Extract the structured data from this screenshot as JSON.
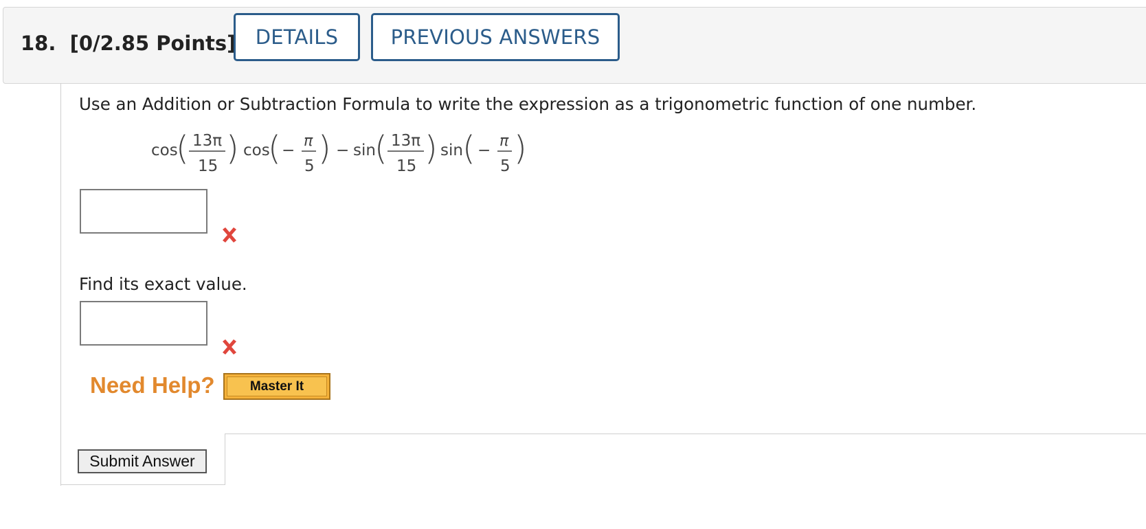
{
  "question": {
    "number": "18.",
    "points": "[0/2.85 Points]",
    "details_label": "DETAILS",
    "previous_answers_label": "PREVIOUS ANSWERS"
  },
  "problem": {
    "prompt": "Use an Addition or Subtraction Formula to write the expression as a trigonometric function of one number.",
    "expression": {
      "t1_fn": "cos",
      "t1_num": "13π",
      "t1_den": "15",
      "t2_fn": "cos",
      "t2_sign": "−",
      "t2_num": "π",
      "t2_den": "5",
      "op": "−",
      "t3_fn": "sin",
      "t3_num": "13π",
      "t3_den": "15",
      "t4_fn": "sin",
      "t4_sign": "−",
      "t4_num": "π",
      "t4_den": "5"
    },
    "answer1_value": "",
    "find_prompt": "Find its exact value.",
    "answer2_value": ""
  },
  "help": {
    "need_help_label": "Need Help?",
    "master_it_label": "Master It"
  },
  "submit_label": "Submit Answer",
  "colors": {
    "accent": "#2b5c8a",
    "incorrect": "#e0463d",
    "help": "#e2892e",
    "button_yellow": "#f5b23a"
  },
  "icons": {
    "incorrect": "x-mark-icon"
  }
}
